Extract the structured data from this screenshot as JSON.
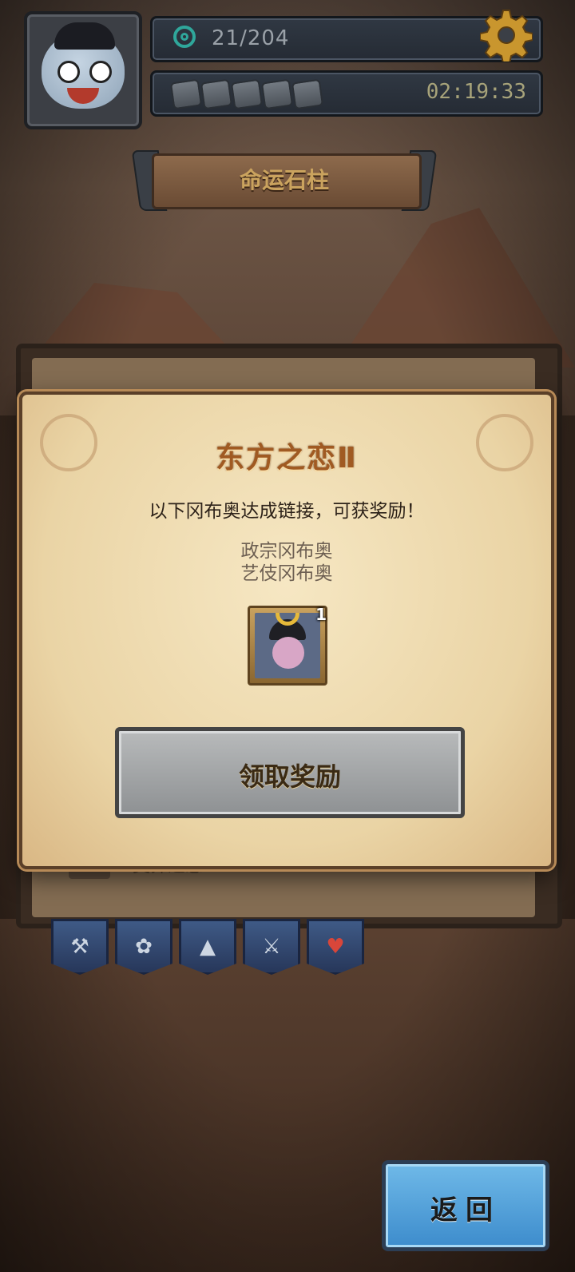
{
  "hud": {
    "energy": "21/204",
    "timer": "02:19:33",
    "stone_slots": 5
  },
  "header": {
    "title": "命运石柱"
  },
  "background_panel": {
    "row_text": "奥莽之恋"
  },
  "modal": {
    "title": "东方之恋Ⅱ",
    "subtitle": "以下冈布奥达成链接，可获奖励！",
    "linked_names": [
      "政宗冈布奥",
      "艺伎冈布奥"
    ],
    "reward": {
      "icon": "samurai-gumball-icon",
      "count": "1"
    },
    "claim_button": "领取奖励"
  },
  "back_button": "返回",
  "colors": {
    "modal_title": "#a05a22",
    "back_button": "#4fa0dc",
    "claim_button": "#a3a6a8"
  }
}
